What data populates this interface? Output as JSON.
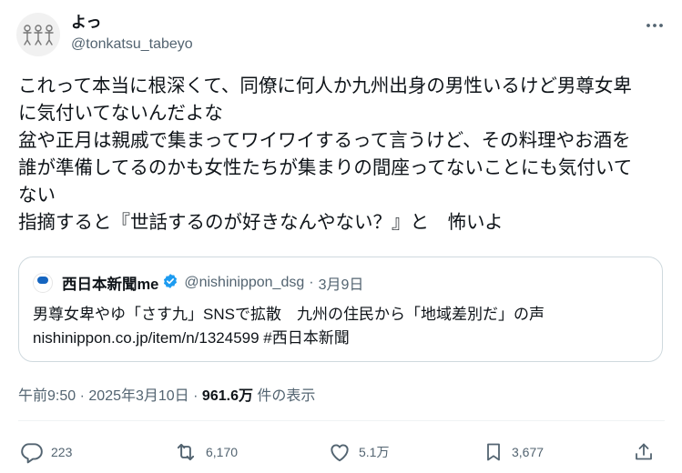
{
  "author": {
    "display_name": "よっ",
    "handle": "@tonkatsu_tabeyo"
  },
  "more_icon": "more-horizontal-icon",
  "body_lines": [
    "これって本当に根深くて、同僚に何人か九州出身の男性いるけど男尊女卑",
    "に気付いてないんだよな",
    "盆や正月は親戚で集まってワイワイするって言うけど、その料理やお酒を",
    "誰が準備してるのかも女性たちが集まりの間座ってないことにも気付いて",
    "ない",
    "指摘すると『世話するのが好きなんやない？』と　怖いよ"
  ],
  "quote": {
    "name": "西日本新聞me",
    "handle": "@nishinippon_dsg",
    "separator": "·",
    "date": "3月9日",
    "text_line1": "男尊女卑やゆ「さす九」SNSで拡散　九州の住民から「地域差別だ」の声",
    "text_line2": "nishinippon.co.jp/item/n/1324599 #西日本新聞",
    "verified_color": "#1d9bf0"
  },
  "meta": {
    "time": "午前9:50",
    "separator": "·",
    "date": "2025年3月10日",
    "separator2": "·",
    "views_count": "961.6万",
    "views_label": "件の表示"
  },
  "actions": {
    "reply_count": "223",
    "retweet_count": "6,170",
    "like_count": "5.1万",
    "bookmark_count": "3,677"
  },
  "colors": {
    "text": "#0f1419",
    "secondary": "#536471",
    "border": "#cfd9de",
    "accent": "#1d9bf0"
  }
}
